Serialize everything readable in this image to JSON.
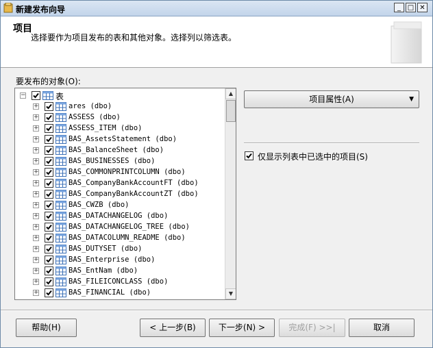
{
  "window": {
    "title": "新建发布向导"
  },
  "header": {
    "title": "项目",
    "description": "选择要作为项目发布的表和其他对象。选择列以筛选表。"
  },
  "objects_label": "要发布的对象(O):",
  "tree": {
    "root_label": "表",
    "items": [
      "ares (dbo)",
      "ASSESS (dbo)",
      "ASSESS_ITEM (dbo)",
      "BAS_AssetsStatement (dbo)",
      "BAS_BalanceSheet (dbo)",
      "BAS_BUSINESSES (dbo)",
      "BAS_COMMONPRINTCOLUMN (dbo)",
      "BAS_CompanyBankAccountFT (dbo)",
      "BAS_CompanyBankAccountZT (dbo)",
      "BAS_CWZB (dbo)",
      "BAS_DATACHANGELOG (dbo)",
      "BAS_DATACHANGELOG_TREE (dbo)",
      "BAS_DATACOLUMN_README (dbo)",
      "BAS_DUTYSET (dbo)",
      "BAS_Enterprise (dbo)",
      "BAS_EntNam (dbo)",
      "BAS_FILEICONCLASS (dbo)",
      "BAS_FINANCIAL (dbo)"
    ]
  },
  "item_properties_button": "项目属性(A)",
  "show_only_checked_label": "仅显示列表中已选中的项目(S)",
  "buttons": {
    "help": "帮助(H)",
    "back": "< 上一步(B)",
    "next": "下一步(N) >",
    "finish": "完成(F) >>|",
    "cancel": "取消"
  }
}
